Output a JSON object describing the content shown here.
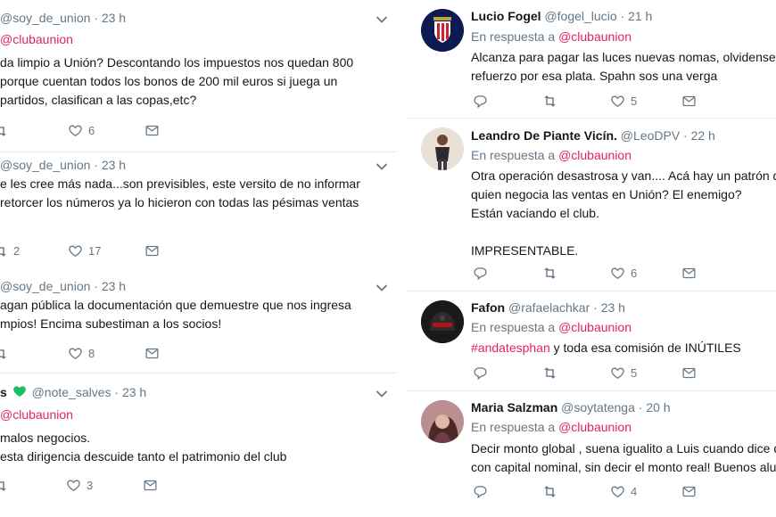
{
  "left_tweets": [
    {
      "user_prefix": "",
      "handle": "@soy_de_union",
      "time": "· 23 h",
      "reply_mention": "@clubaunion",
      "lines": [
        "da limpio a Unión? Descontando los impuestos nos quedan 800",
        " porque cuentan todos los bonos de 200 mil euros si juega un",
        "partidos, clasifican a las copas,etc?"
      ],
      "retweets": "",
      "likes": "6"
    },
    {
      "user_prefix": "",
      "handle": "@soy_de_union",
      "time": "· 23 h",
      "reply_mention": "",
      "lines": [
        "e les cree más nada...son previsibles, este versito de no informar",
        "retorcer los números ya lo hicieron con todas las pésimas ventas"
      ],
      "retweets": "2",
      "likes": "17"
    },
    {
      "user_prefix": "",
      "handle": "@soy_de_union",
      "time": "· 23 h",
      "reply_mention": "",
      "lines": [
        "agan pública la documentación que demuestre que nos ingresa",
        "mpios! Encima subestiman a los socios!"
      ],
      "retweets": "",
      "likes": "8"
    },
    {
      "user_prefix": "s",
      "handle": "@note_salves",
      "time": "· 23 h",
      "reply_mention": "@clubaunion",
      "lines": [
        " malos negocios.",
        "esta dirigencia  descuide tanto el patrimonio del club"
      ],
      "retweets": "",
      "likes": "3"
    }
  ],
  "right_tweets": [
    {
      "name": "Lucio Fogel",
      "handle": "@fogel_lucio",
      "time": "· 21 h",
      "reply_prefix": "En respuesta a",
      "reply_mention": "@clubaunion",
      "lines": [
        "Alcanza para pagar las luces nuevas nomas, olvidense de",
        "refuerzo por esa plata. Spahn sos una verga"
      ],
      "likes": "5",
      "avatar": "club-crest-avatar"
    },
    {
      "name": "Leandro De Piante Vicín.",
      "handle": "@LeoDPV",
      "time": "· 22 h",
      "reply_prefix": "En respuesta a",
      "reply_mention": "@clubaunion",
      "lines": [
        "Otra operación desastrosa y van.... Acá hay un patrón de",
        "quien negocia las ventas en Unión? El enemigo?",
        "Están vaciando el club.",
        "",
        "IMPRESENTABLE."
      ],
      "likes": "6",
      "avatar": "person-avatar"
    },
    {
      "name": "Fafon",
      "handle": "@rafaelachkar",
      "time": "· 23 h",
      "reply_prefix": "En respuesta a",
      "reply_mention": "@clubaunion",
      "hashtag": "#andatesphan",
      "lines": [
        " y toda esa comisión de INÚTILES"
      ],
      "likes": "5",
      "avatar": "helmet-avatar"
    },
    {
      "name": "Maria Salzman",
      "handle": "@soytatenga",
      "time": "· 20 h",
      "reply_prefix": "En respuesta a",
      "reply_mention": "@clubaunion",
      "lines": [
        "Decir monto global , suena igualito a Luis cuando dice qu",
        "con capital nominal, sin decir el monto real! Buenos alum"
      ],
      "likes": "4",
      "avatar": "woman-avatar"
    }
  ],
  "colors": {
    "accent": "#e0245e",
    "muted": "#657786",
    "divider": "#e6ecf0",
    "heart_green": "#17bf63"
  }
}
